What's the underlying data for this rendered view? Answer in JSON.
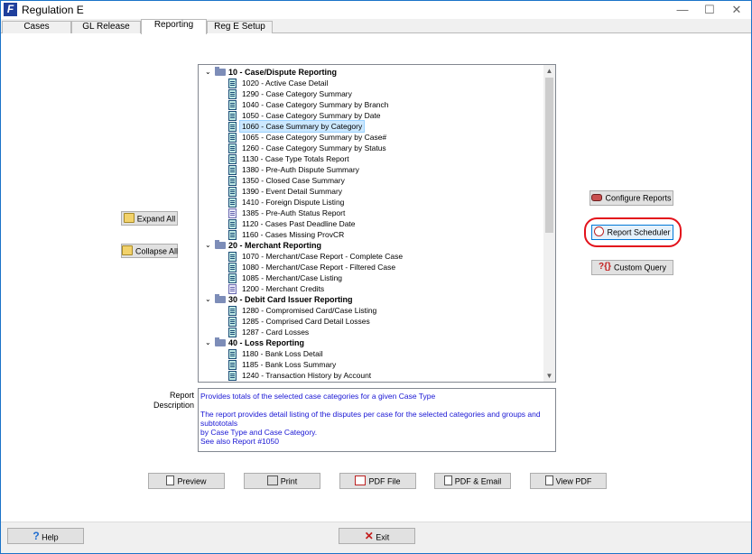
{
  "window": {
    "title": "Regulation E",
    "app_icon_letter": "F",
    "controls": {
      "minimize": "—",
      "maximize": "☐",
      "close": "✕"
    }
  },
  "tabs": [
    {
      "label": "Cases",
      "active": false
    },
    {
      "label": "GL Release",
      "active": false
    },
    {
      "label": "Reporting",
      "active": true
    },
    {
      "label": "Reg E Setup",
      "active": false
    }
  ],
  "tree": {
    "groups": [
      {
        "label": "10 - Case/Dispute Reporting",
        "expanded": true,
        "items": [
          {
            "label": "1020 - Active Case Detail",
            "icon": "report-icon"
          },
          {
            "label": "1290 - Case Category Summary",
            "icon": "report-icon"
          },
          {
            "label": "1040 - Case Category Summary by Branch",
            "icon": "report-icon"
          },
          {
            "label": "1050 - Case Category Summary by Date",
            "icon": "report-icon"
          },
          {
            "label": "1060 - Case Summary by Category",
            "icon": "report-icon",
            "selected": true
          },
          {
            "label": "1065 - Case Category Summary by Case#",
            "icon": "report-icon"
          },
          {
            "label": "1260 - Case Category Summary by Status",
            "icon": "report-icon"
          },
          {
            "label": "1130 - Case Type Totals Report",
            "icon": "report-icon"
          },
          {
            "label": "1380 - Pre-Auth Dispute Summary",
            "icon": "report-icon"
          },
          {
            "label": "1350 - Closed Case Summary",
            "icon": "report-icon"
          },
          {
            "label": "1390 - Event Detail Summary",
            "icon": "report-icon"
          },
          {
            "label": "1410 - Foreign Dispute Listing",
            "icon": "report-icon"
          },
          {
            "label": "1385 - Pre-Auth Status Report",
            "icon": "document-icon"
          },
          {
            "label": "1120 - Cases Past Deadline Date",
            "icon": "report-icon"
          },
          {
            "label": "1160 - Cases Missing ProvCR",
            "icon": "report-icon"
          }
        ]
      },
      {
        "label": "20 - Merchant Reporting",
        "expanded": true,
        "items": [
          {
            "label": "1070 - Merchant/Case Report - Complete Case",
            "icon": "report-icon"
          },
          {
            "label": "1080 - Merchant/Case Report - Filtered Case",
            "icon": "report-icon"
          },
          {
            "label": "1085 - Merchant/Case Listing",
            "icon": "report-icon"
          },
          {
            "label": "1200 - Merchant Credits",
            "icon": "document-icon"
          }
        ]
      },
      {
        "label": "30 - Debit Card Issuer Reporting",
        "expanded": true,
        "items": [
          {
            "label": "1280 - Compromised Card/Case Listing",
            "icon": "report-icon"
          },
          {
            "label": "1285 - Comprised Card Detail Losses",
            "icon": "report-icon"
          },
          {
            "label": "1287 - Card Losses",
            "icon": "report-icon"
          }
        ]
      },
      {
        "label": "40 - Loss Reporting",
        "expanded": true,
        "items": [
          {
            "label": "1180 - Bank Loss Detail",
            "icon": "report-icon"
          },
          {
            "label": "1185 - Bank Loss Summary",
            "icon": "report-icon"
          },
          {
            "label": "1240 - Transaction History by Account",
            "icon": "report-icon"
          }
        ]
      }
    ]
  },
  "left_buttons": {
    "expand_all": "Expand All",
    "collapse_all": "Collapse All"
  },
  "right_buttons": {
    "configure_reports": "Configure Reports",
    "report_scheduler": "Report Scheduler",
    "custom_query": "Custom Query"
  },
  "description": {
    "label_line1": "Report",
    "label_line2": "Description",
    "summary": "Provides totals of the selected case categories for a given Case Type",
    "detail_line1": "The report provides detail listing of the disputes per case for the selected categories and groups and subtototals",
    "detail_line2": "by Case Type and Case Category.",
    "see_also": "See also Report #1050"
  },
  "action_buttons": {
    "preview": "Preview",
    "print": "Print",
    "pdf_file": "PDF File",
    "pdf_email": "PDF & Email",
    "view_pdf": "View PDF"
  },
  "footer": {
    "help": "Help",
    "exit": "Exit"
  },
  "colors": {
    "accent_blue": "#1a17d4",
    "highlight_red": "#e3121b",
    "selection": "#cce8ff"
  }
}
